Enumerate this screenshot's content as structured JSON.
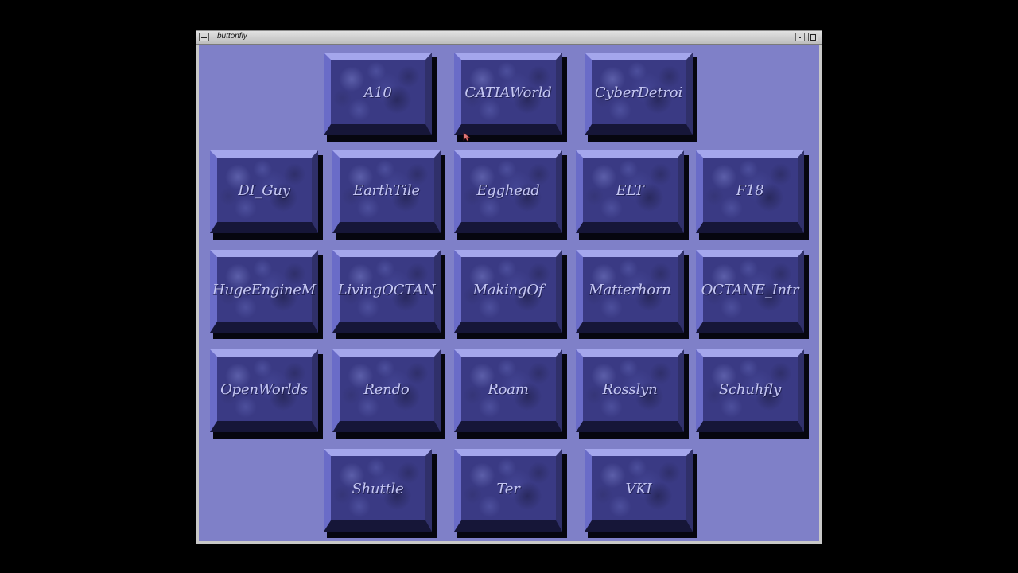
{
  "window": {
    "title": "buttonfly",
    "icons": {
      "menu": "window-menu-icon",
      "minimize": "minimize-icon",
      "maximize": "maximize-icon"
    }
  },
  "colors": {
    "background": "#7f80c8",
    "tile_face": "#3a3a84",
    "tile_label": "#c4c6f2"
  },
  "buttons": [
    {
      "label": "A10"
    },
    {
      "label": "CATIAWorld"
    },
    {
      "label": "CyberDetroi"
    },
    {
      "label": "DI_Guy"
    },
    {
      "label": "EarthTile"
    },
    {
      "label": "Egghead"
    },
    {
      "label": "ELT"
    },
    {
      "label": "F18"
    },
    {
      "label": "HugeEngineM"
    },
    {
      "label": "LivingOCTAN"
    },
    {
      "label": "MakingOf"
    },
    {
      "label": "Matterhorn"
    },
    {
      "label": "OCTANE_Intr"
    },
    {
      "label": "OpenWorlds"
    },
    {
      "label": "Rendo"
    },
    {
      "label": "Roam"
    },
    {
      "label": "Rosslyn"
    },
    {
      "label": "Schuhfly"
    },
    {
      "label": "Shuttle"
    },
    {
      "label": "Ter"
    },
    {
      "label": "VKI"
    }
  ]
}
